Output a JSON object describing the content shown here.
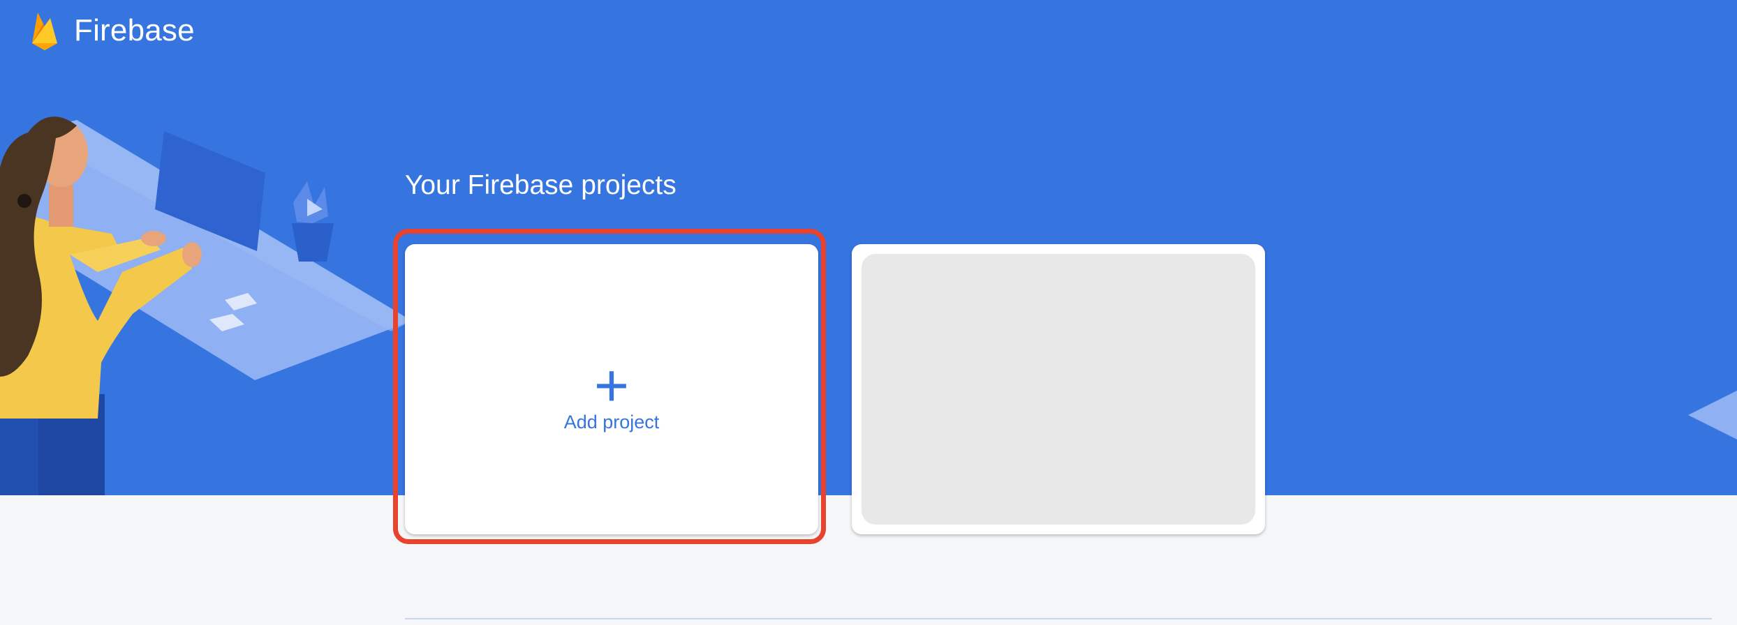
{
  "header": {
    "brand_name": "Firebase",
    "logo_icon": "firebase-flame-icon"
  },
  "projects": {
    "section_title": "Your Firebase projects",
    "add_card": {
      "plus_glyph": "+",
      "label": "Add project"
    },
    "placeholder_card": {
      "state": "loading-skeleton"
    }
  },
  "colors": {
    "hero_blue": "#3674e0",
    "page_bg": "#f4f6f8",
    "accent_text": "#3674e0",
    "highlight_red": "#e8432f",
    "skeleton_gray": "#e8e8e8"
  }
}
